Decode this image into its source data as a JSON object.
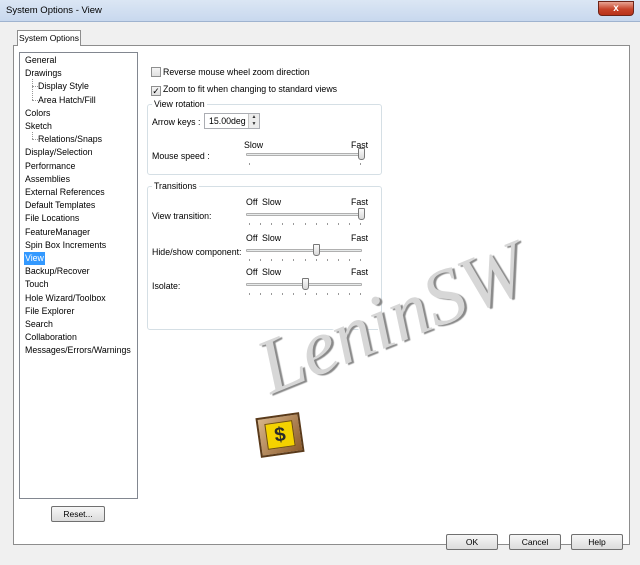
{
  "window": {
    "title": "System Options - View",
    "close_glyph": "x"
  },
  "tab": {
    "label": "System Options"
  },
  "tree": {
    "items": [
      {
        "label": "General",
        "level": 0
      },
      {
        "label": "Drawings",
        "level": 0
      },
      {
        "label": "Display Style",
        "level": 1
      },
      {
        "label": "Area Hatch/Fill",
        "level": 1
      },
      {
        "label": "Colors",
        "level": 0
      },
      {
        "label": "Sketch",
        "level": 0
      },
      {
        "label": "Relations/Snaps",
        "level": 1
      },
      {
        "label": "Display/Selection",
        "level": 0
      },
      {
        "label": "Performance",
        "level": 0
      },
      {
        "label": "Assemblies",
        "level": 0
      },
      {
        "label": "External References",
        "level": 0
      },
      {
        "label": "Default Templates",
        "level": 0
      },
      {
        "label": "File Locations",
        "level": 0
      },
      {
        "label": "FeatureManager",
        "level": 0
      },
      {
        "label": "Spin Box Increments",
        "level": 0
      },
      {
        "label": "View",
        "level": 0,
        "selected": true
      },
      {
        "label": "Backup/Recover",
        "level": 0
      },
      {
        "label": "Touch",
        "level": 0
      },
      {
        "label": "Hole Wizard/Toolbox",
        "level": 0
      },
      {
        "label": "File Explorer",
        "level": 0
      },
      {
        "label": "Search",
        "level": 0
      },
      {
        "label": "Collaboration",
        "level": 0
      },
      {
        "label": "Messages/Errors/Warnings",
        "level": 0
      }
    ]
  },
  "reset_button": "Reset...",
  "options": {
    "reverse_wheel": {
      "label": "Reverse mouse wheel zoom direction",
      "checked": false
    },
    "zoom_to_fit": {
      "label": "Zoom to fit when changing to standard views",
      "checked": true
    }
  },
  "view_rotation": {
    "title": "View rotation",
    "arrow_keys_label": "Arrow keys :",
    "arrow_keys_value": "15.00deg",
    "mouse_speed_label": "Mouse speed :",
    "slow": "Slow",
    "fast": "Fast",
    "mouse_speed_level": 1.0
  },
  "transitions": {
    "title": "Transitions",
    "off": "Off",
    "slow": "Slow",
    "fast": "Fast",
    "rows": [
      {
        "label": "View transition:",
        "level": 1.0
      },
      {
        "label": "Hide/show component:",
        "level": 0.6
      },
      {
        "label": "Isolate:",
        "level": 0.5
      }
    ]
  },
  "buttons": {
    "ok": "OK",
    "cancel": "Cancel",
    "help": "Help"
  },
  "watermark": {
    "text": "LeninSW",
    "logo_glyph": "$"
  }
}
